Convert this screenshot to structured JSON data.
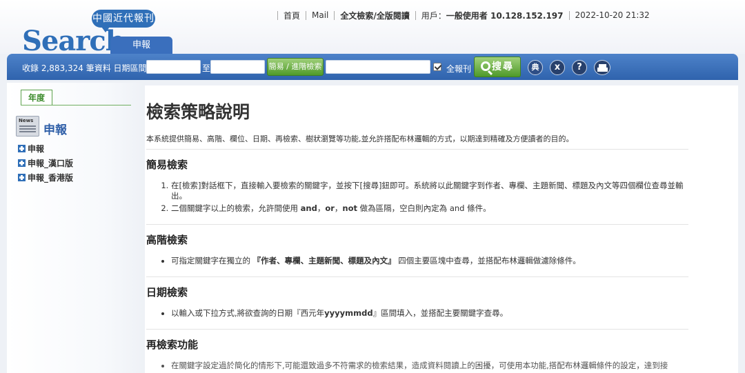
{
  "header": {
    "logo_bubble": "中國近代報刊",
    "logo_text": "Search",
    "active_tab": "申報",
    "nav": {
      "home": "首頁",
      "mail": "Mail",
      "fulltext": "全文檢索/全版閱讀",
      "user_label": "用戶：",
      "user_value": "一般使用者 10.128.152.197",
      "datetime": "2022-10-20 21:32"
    }
  },
  "toolbar": {
    "count_text": "收錄 2,883,324 筆資料 日期區間:",
    "date_from": "",
    "to_label": "至",
    "date_to": "",
    "advanced_label": "簡易 / 進階檢索",
    "keyword": "",
    "all_papers_label": "全報刊",
    "search_label": "搜尋",
    "dict_label": "典",
    "clear_label": "x",
    "help_label": "?"
  },
  "sidebar": {
    "tab_label": "年度",
    "title": "申報",
    "items": [
      "申報",
      "申報_漢口版",
      "申報_香港版"
    ]
  },
  "main": {
    "title": "檢索策略說明",
    "intro": "本系統提供簡易、高階、欄位、日期、再檢索、樹狀瀏覽等功能,並允許搭配布林邏輯的方式，以期達到精確及方便讀者的目的。",
    "simple": {
      "title": "簡易檢索",
      "item1": "在[檢索]對話框下，直接輸入要檢索的關鍵字，並按下[搜尋]鈕即可。系統將以此關鍵字到作者、專欄、主題新聞、標題及內文等四個欄位查尋並輸出。",
      "item2_pre": "二個關鍵字以上的檢索，允許間使用 ",
      "item2_and": "and",
      "item2_c1": "，",
      "item2_or": "or",
      "item2_c2": "，",
      "item2_not": "not",
      "item2_post": " 做為區隔，空白則內定為 and 條件。"
    },
    "advanced": {
      "title": "高階檢索",
      "pre": "可指定關鍵字在獨立的 ",
      "bold": "『作者、專欄、主題新聞、標題及內文』",
      "post": " 四個主要區塊中查尋，並搭配布林邏輯做濾除條件。"
    },
    "date": {
      "title": "日期檢索",
      "pre": "以輸入或下拉方式,將欲查詢的日期『西元年",
      "bold": "yyyymmdd",
      "post": "』區間填入，並搭配主要關鍵字查尋。"
    },
    "refine": {
      "title": "再檢索功能",
      "item": "在關鍵字設定過於簡化的情形下,可能還致過多不符需求的檢索結果，造成資料閱讀上的困擾，可使用本功能,搭配布林邏輯條件的設定，達到接"
    }
  }
}
